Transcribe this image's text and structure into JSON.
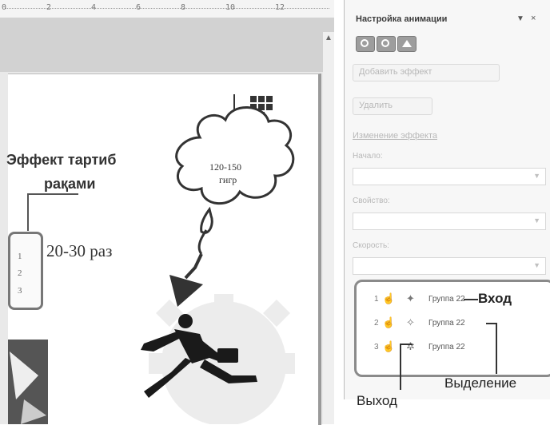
{
  "ruler": {
    "ticks": [
      "0",
      "2",
      "4",
      "6",
      "8",
      "10",
      "12"
    ]
  },
  "slide": {
    "effect_order_label_line1": "Эффект тартиб",
    "effect_order_label_line2": "рақами",
    "times_label": "20-30 раз",
    "cloud_text_line1": "120-150",
    "cloud_text_line2": "гигр",
    "order_numbers": [
      "1",
      "2",
      "3"
    ]
  },
  "pane": {
    "title": "Настройка анимации",
    "dropdown_glyph": "▼",
    "close_glyph": "×",
    "change_effect_label": "Добавить эффект",
    "remove_label": "Удалить",
    "modify_label": "Изменение эффекта",
    "start_label": "Начало:",
    "property_label": "Свойство:",
    "speed_label": "Скорость:",
    "effects": [
      {
        "index": "1",
        "name": "Группа 22"
      },
      {
        "index": "2",
        "name": "Группа 22"
      },
      {
        "index": "3",
        "name": "Группа 22"
      }
    ]
  },
  "annotations": {
    "entrance": "Вход",
    "emphasis": "Выделение",
    "exit": "Выход"
  },
  "colors": {
    "pane_bg": "#f7f7f7",
    "box_border": "#8a8a8a",
    "nav_button": "#9d9d9d"
  },
  "icons": [
    "mouse-click-icon",
    "entrance-effect-icon",
    "emphasis-effect-icon",
    "exit-effect-icon",
    "home-icon",
    "play-icon",
    "stop-icon"
  ]
}
